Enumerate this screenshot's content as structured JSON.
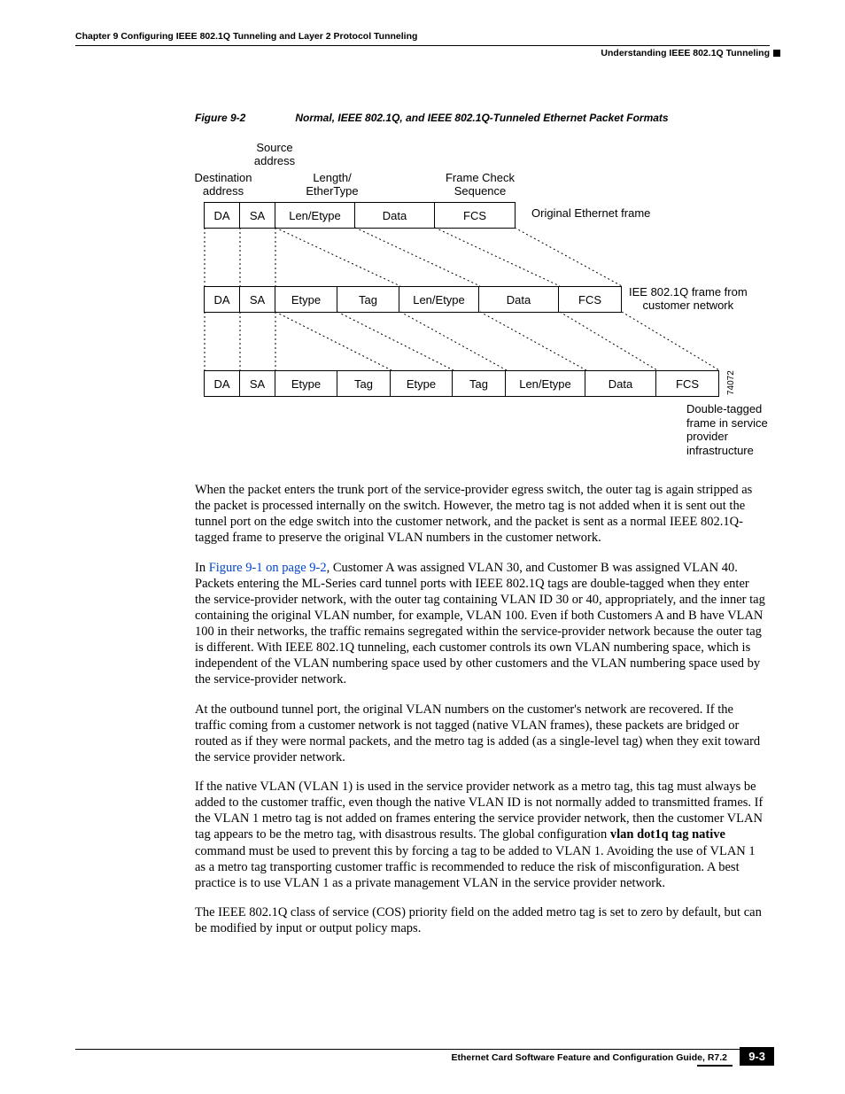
{
  "header": {
    "chapter": "Chapter 9   Configuring IEEE 802.1Q Tunneling and Layer 2 Protocol Tunneling",
    "section": "Understanding IEEE 802.1Q Tunneling"
  },
  "figure": {
    "num": "Figure 9-2",
    "title": "Normal, IEEE 802.1Q, and IEEE 802.1Q-Tunneled Ethernet Packet Formats",
    "labels": {
      "source_addr": "Source\naddress",
      "dest_addr": "Destination\naddress",
      "len_etype": "Length/\nEtherType",
      "fcs_label": "Frame Check\nSequence",
      "row1_right": "Original Ethernet frame",
      "row2_right": "IEE 802.1Q frame from\ncustomer network",
      "row3_bottom": "Double-tagged\nframe in service\nprovider\ninfrastructure",
      "fig_id": "74072"
    },
    "row1": [
      "DA",
      "SA",
      "Len/Etype",
      "Data",
      "FCS"
    ],
    "row2": [
      "DA",
      "SA",
      "Etype",
      "Tag",
      "Len/Etype",
      "Data",
      "FCS"
    ],
    "row3": [
      "DA",
      "SA",
      "Etype",
      "Tag",
      "Etype",
      "Tag",
      "Len/Etype",
      "Data",
      "FCS"
    ]
  },
  "body": {
    "p1": "When the packet enters the trunk port of the service-provider egress switch, the outer tag is again stripped as the packet is processed internally on the switch. However, the metro tag is not added when it is sent out the tunnel port on the edge switch into the customer network, and the packet is sent as a normal IEEE 802.1Q-tagged frame to preserve the original VLAN numbers in the customer network.",
    "p2a": "In ",
    "p2link": "Figure 9-1 on page 9-2",
    "p2b": ", Customer A was assigned VLAN 30, and Customer B was assigned VLAN 40. Packets entering the ML-Series card tunnel ports with IEEE 802.1Q tags are double-tagged when they enter the service-provider network, with the outer tag containing VLAN ID 30 or 40, appropriately, and the inner tag containing the original VLAN number, for example, VLAN 100. Even if both Customers A and B have VLAN 100 in their networks, the traffic remains segregated within the service-provider network because the outer tag is different. With IEEE 802.1Q tunneling, each customer controls its own VLAN numbering space, which is independent of the VLAN numbering space used by other customers and the VLAN numbering space used by the service-provider network.",
    "p3": "At the outbound tunnel port, the original VLAN numbers on the customer's network are recovered. If the traffic coming from a customer network is not tagged (native VLAN frames), these packets are bridged or routed as if they were normal packets, and the metro tag is added (as a single-level tag) when they exit toward the service provider network.",
    "p4a": "If the native VLAN (VLAN 1) is used in the service provider network as a metro tag, this tag must always be added to the customer traffic, even though the native VLAN ID is not normally added to transmitted frames. If the VLAN 1 metro tag is not added on frames entering the service provider network, then the customer VLAN tag appears to be the metro tag, with disastrous results. The global configuration ",
    "p4bold": "vlan dot1q tag native",
    "p4b": " command must be used to prevent this by forcing a tag to be added to VLAN 1. Avoiding the use of VLAN 1 as a metro tag transporting customer traffic is recommended to reduce the risk of misconfiguration. A best practice is to use VLAN 1 as a private management VLAN in the service provider network.",
    "p5": "The IEEE 802.1Q class of service (COS) priority field on the added metro tag is set to zero by default, but can be modified by input or output policy maps."
  },
  "footer": {
    "title": "Ethernet Card Software Feature and Configuration Guide, R7.2",
    "page": "9-3"
  },
  "chart_data": {
    "type": "table",
    "title": "Normal, IEEE 802.1Q, and IEEE 802.1Q-Tunneled Ethernet Packet Formats",
    "rows": [
      {
        "name": "Original Ethernet frame",
        "fields": [
          "DA",
          "SA",
          "Len/Etype",
          "Data",
          "FCS"
        ]
      },
      {
        "name": "IEE 802.1Q frame from customer network",
        "fields": [
          "DA",
          "SA",
          "Etype",
          "Tag",
          "Len/Etype",
          "Data",
          "FCS"
        ]
      },
      {
        "name": "Double-tagged frame in service provider infrastructure",
        "fields": [
          "DA",
          "SA",
          "Etype",
          "Tag",
          "Etype",
          "Tag",
          "Len/Etype",
          "Data",
          "FCS"
        ]
      }
    ],
    "column_labels": {
      "DA": "Destination address",
      "SA": "Source address",
      "Len/Etype": "Length/EtherType",
      "FCS": "Frame Check Sequence"
    }
  }
}
